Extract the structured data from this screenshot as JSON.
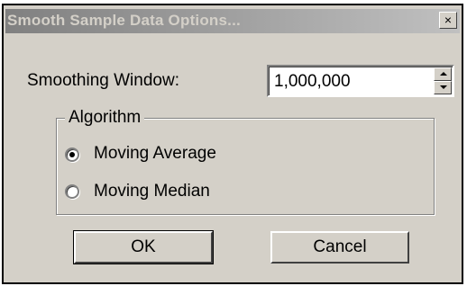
{
  "window": {
    "title": "Smooth Sample Data Options...",
    "close_glyph": "×"
  },
  "smoothing": {
    "label": "Smoothing Window:",
    "value": "1,000,000"
  },
  "algorithm": {
    "group_label": "Algorithm",
    "options": [
      {
        "label": "Moving Average",
        "selected": true
      },
      {
        "label": "Moving Median",
        "selected": false
      }
    ]
  },
  "buttons": {
    "ok_label": "OK",
    "cancel_label": "Cancel"
  },
  "icons": {
    "close": "close-icon",
    "spin_up": "spin-up-icon",
    "spin_down": "spin-down-icon"
  },
  "colors": {
    "dialog_face": "#d4d0c8",
    "title_gradient_start": "#808080",
    "title_gradient_end": "#c0c0c0",
    "title_text": "#d4d0c8"
  }
}
